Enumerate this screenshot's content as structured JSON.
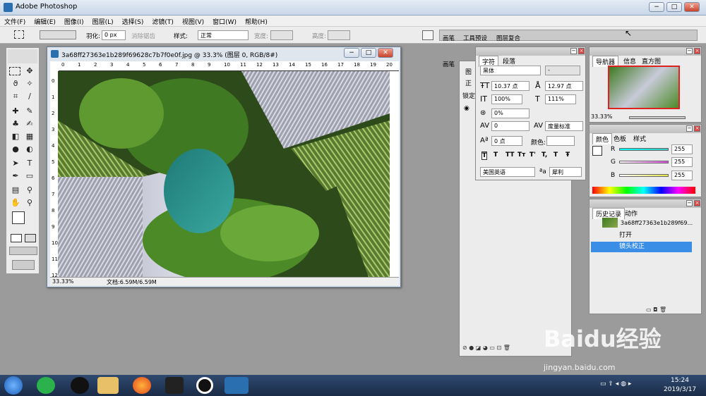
{
  "app": {
    "title": "Adobe Photoshop",
    "min": "−",
    "max": "□",
    "close": "✕"
  },
  "menu": [
    "文件(F)",
    "编辑(E)",
    "图像(I)",
    "图层(L)",
    "选择(S)",
    "滤镜(T)",
    "视图(V)",
    "窗口(W)",
    "帮助(H)"
  ],
  "options": {
    "feather_label": "羽化:",
    "feather_value": "0 px",
    "antialias": "消除锯齿",
    "style_label": "样式:",
    "style_value": "正常",
    "width_label": "宽度:",
    "height_label": "高度:",
    "tabs": [
      "画笔",
      "工具预设",
      "图层复合"
    ]
  },
  "document": {
    "title": "3a68ff27363e1b289f69628c7b7f0e0f.jpg @ 33.3% (图层 0, RGB/8#)",
    "zoom": "33.33%",
    "doc_info": "文档:6.59M/6.59M",
    "ruler_top": [
      "0",
      "1",
      "2",
      "3",
      "4",
      "5",
      "6",
      "7",
      "8",
      "9",
      "10",
      "11",
      "12",
      "13",
      "14",
      "15",
      "16",
      "17",
      "18",
      "19",
      "20"
    ],
    "ruler_left": [
      "0",
      "1",
      "2",
      "3",
      "4",
      "5",
      "6",
      "7",
      "8",
      "9",
      "10",
      "11",
      "12"
    ]
  },
  "layers_panel": {
    "tab1": "图",
    "row1": "正",
    "row2": "锁定"
  },
  "character": {
    "tabs": [
      "字符",
      "段落"
    ],
    "font": "黑体",
    "style": "-",
    "size": "10.37 点",
    "leading": "12.97 点",
    "vscale": "100%",
    "hscale": "111%",
    "tracking": "0%",
    "kerning": "0",
    "kerning2": "度量标准",
    "baseline": "0 点",
    "color_label": "颜色:",
    "language": "美国英语",
    "aa_label": "ªa",
    "aa_value": "犀利",
    "styles": [
      "T",
      "T",
      "TT",
      "Tт",
      "T'",
      "T,",
      "T",
      "Ŧ"
    ]
  },
  "navigator": {
    "tabs": [
      "导航器",
      "信息",
      "直方图"
    ],
    "zoom": "33.33%"
  },
  "color": {
    "tabs": [
      "颜色",
      "色板",
      "样式"
    ],
    "r_label": "R",
    "r": "255",
    "g_label": "G",
    "g": "255",
    "b_label": "B",
    "b": "255",
    "colors": {
      "r": "#3ec7c0",
      "g": "#e04ee0",
      "b": "#e8e84a"
    }
  },
  "history": {
    "tabs": [
      "历史记录",
      "动作"
    ],
    "snapshot": "3a68ff27363e1b289f69...",
    "items": [
      "打开",
      "镜头校正"
    ]
  },
  "taskbar": {
    "time": "15:24",
    "date": "2019/3/17"
  },
  "watermark": {
    "brand": "Baidu经验",
    "url": "jingyan.baidu.com"
  }
}
